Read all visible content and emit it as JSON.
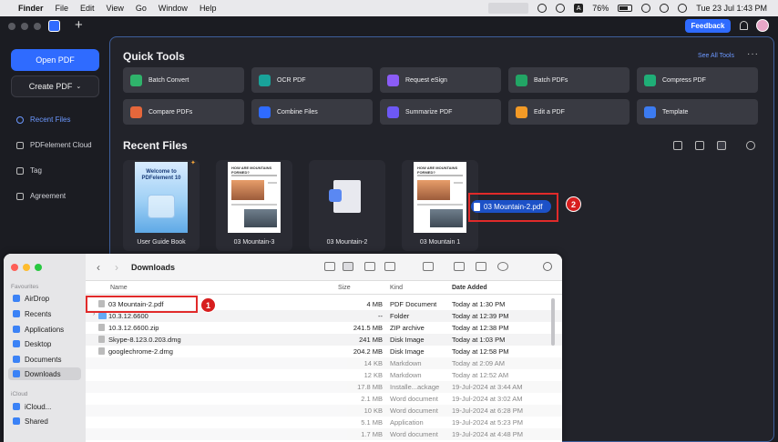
{
  "menubar": {
    "app": "Finder",
    "items": [
      "File",
      "Edit",
      "View",
      "Go",
      "Window",
      "Help"
    ],
    "battery": "76%",
    "clock": "Tue 23 Jul  1:43 PM"
  },
  "appbar": {
    "feedback": "Feedback"
  },
  "sidebar": {
    "open_pdf": "Open PDF",
    "create_pdf": "Create PDF",
    "nav": [
      {
        "label": "Recent Files",
        "icon": "clock-icon"
      },
      {
        "label": "PDFelement Cloud",
        "icon": "cloud-icon"
      },
      {
        "label": "Tag",
        "icon": "tag-icon"
      },
      {
        "label": "Agreement",
        "icon": "agreement-icon"
      }
    ]
  },
  "quick_tools": {
    "title": "Quick Tools",
    "see_all": "See All Tools",
    "more": "···",
    "tools": [
      {
        "label": "Batch Convert",
        "color": "#2fb36b"
      },
      {
        "label": "OCR PDF",
        "color": "#19a39a"
      },
      {
        "label": "Request eSign",
        "color": "#8b5cf6"
      },
      {
        "label": "Batch PDFs",
        "color": "#22a565"
      },
      {
        "label": "Compress PDF",
        "color": "#1fae77"
      },
      {
        "label": "Compare PDFs",
        "color": "#e5673b"
      },
      {
        "label": "Combine Files",
        "color": "#2f6bff"
      },
      {
        "label": "Summarize PDF",
        "color": "#6d58f5"
      },
      {
        "label": "Edit a PDF",
        "color": "#f39a26"
      },
      {
        "label": "Template",
        "color": "#3c7bf0"
      }
    ]
  },
  "recent": {
    "title": "Recent Files",
    "files": [
      {
        "label": "User Guide Book",
        "thumb_title": "Welcome to PDFelement 10"
      },
      {
        "label": "03 Mountain-3",
        "thumb_title": "HOW ARE MOUNTAINS FORMED?"
      },
      {
        "label": "03 Mountain-2",
        "thumb_title": ""
      },
      {
        "label": "03 Mountain 1",
        "thumb_title": "HOW ARE MOUNTAINS FORMED?"
      }
    ]
  },
  "drag": {
    "file": "03 Mountain-2.pdf",
    "step": "2"
  },
  "finder": {
    "title": "Downloads",
    "step": "1",
    "sidebar": {
      "favourites_label": "Favourites",
      "favourites": [
        "AirDrop",
        "Recents",
        "Applications",
        "Desktop",
        "Documents",
        "Downloads"
      ],
      "icloud_label": "iCloud",
      "icloud": [
        "iCloud...",
        "Shared"
      ]
    },
    "columns": {
      "name": "Name",
      "size": "Size",
      "kind": "Kind",
      "date": "Date Added"
    },
    "rows": [
      {
        "name": "03 Mountain-2.pdf",
        "size": "4 MB",
        "kind": "PDF Document",
        "date": "Today at 1:30 PM",
        "type": "file"
      },
      {
        "name": "10.3.12.6600",
        "size": "--",
        "kind": "Folder",
        "date": "Today at 12:39 PM",
        "type": "folder"
      },
      {
        "name": "10.3.12.6600.zip",
        "size": "241.5 MB",
        "kind": "ZIP archive",
        "date": "Today at 12:38 PM",
        "type": "file"
      },
      {
        "name": "Skype-8.123.0.203.dmg",
        "size": "241 MB",
        "kind": "Disk Image",
        "date": "Today at 1:03 PM",
        "type": "file"
      },
      {
        "name": "googlechrome-2.dmg",
        "size": "204.2 MB",
        "kind": "Disk Image",
        "date": "Today at 12:58 PM",
        "type": "file"
      },
      {
        "name": "",
        "size": "14 KB",
        "kind": "Markdown",
        "date": "Today at 2:09 AM",
        "type": "ghost"
      },
      {
        "name": "",
        "size": "12 KB",
        "kind": "Markdown",
        "date": "Today at 12:52 AM",
        "type": "ghost"
      },
      {
        "name": "",
        "size": "17.8 MB",
        "kind": "Installe...ackage",
        "date": "19-Jul-2024 at 3:44 AM",
        "type": "ghost"
      },
      {
        "name": "",
        "size": "2.1 MB",
        "kind": "Word document",
        "date": "19-Jul-2024 at 3:02 AM",
        "type": "ghost"
      },
      {
        "name": "",
        "size": "10 KB",
        "kind": "Word document",
        "date": "19-Jul-2024 at 6:28 PM",
        "type": "ghost"
      },
      {
        "name": "",
        "size": "5.1 MB",
        "kind": "Application",
        "date": "19-Jul-2024 at 5:23 PM",
        "type": "ghost"
      },
      {
        "name": "",
        "size": "1.7 MB",
        "kind": "Word document",
        "date": "19-Jul-2024 at 4:48 PM",
        "type": "ghost"
      }
    ]
  }
}
